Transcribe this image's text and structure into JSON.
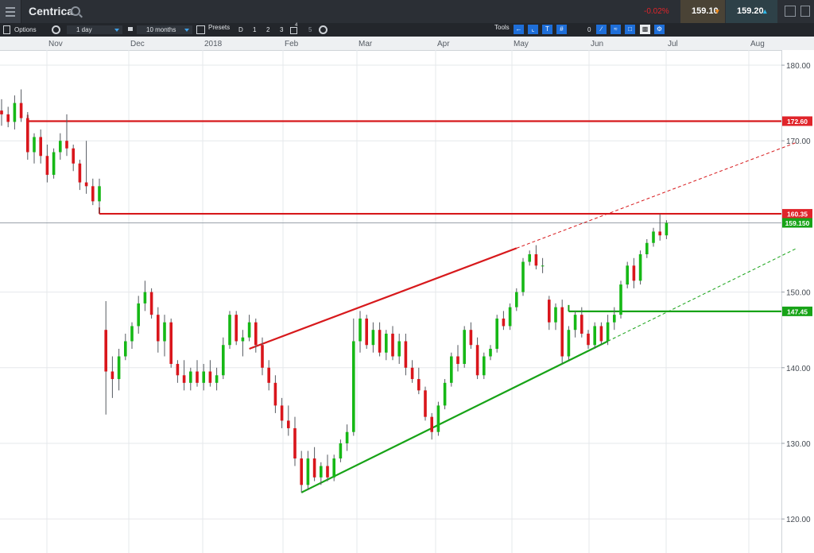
{
  "header": {
    "instrument": "Centrica",
    "change": "-0.02%",
    "sell_price": "159.10",
    "buy_price": "159.20"
  },
  "toolbar": {
    "options_label": "Options",
    "interval": "1 day",
    "range": "10 months",
    "presets_label": "Presets",
    "preset_buttons": [
      "D",
      "1",
      "2",
      "3",
      "4",
      "5"
    ],
    "tools_label": "Tools",
    "tool_zero": "0"
  },
  "chart_data": {
    "type": "candlestick",
    "x_labels": [
      "Nov",
      "Dec",
      "2018",
      "Feb",
      "Mar",
      "Apr",
      "May",
      "Jun",
      "Jul",
      "Aug"
    ],
    "y_ticks": [
      "180.00",
      "170.00",
      "150.00",
      "140.00",
      "130.00",
      "120.00"
    ],
    "ylim": [
      115.5,
      182.0
    ],
    "grid": true,
    "price_tags": [
      {
        "label": "172.60",
        "value": 172.6,
        "color": "#e0242a"
      },
      {
        "label": "160.35",
        "value": 160.35,
        "color": "#e0242a"
      },
      {
        "label": "159.150",
        "value": 159.15,
        "color": "#17a317"
      },
      {
        "label": "147.45",
        "value": 147.45,
        "color": "#17a317"
      }
    ],
    "horizontal_lines": [
      {
        "value": 172.6,
        "from_index": 4,
        "color": "#d7191c"
      },
      {
        "value": 160.35,
        "from_index": 15,
        "color": "#d7191c"
      },
      {
        "value": 147.45,
        "from_index": 87,
        "color": "#17a317"
      }
    ],
    "trend_lines": [
      {
        "from": [
          38,
          142.5
        ],
        "to": [
          79,
          155.8
        ],
        "color": "#d7191c"
      },
      {
        "from": [
          79,
          155.8
        ],
        "to": [
          122,
          169.8
        ],
        "color": "#d7191c",
        "dashed": true
      },
      {
        "from": [
          46,
          123.5
        ],
        "to": [
          93,
          143.5
        ],
        "color": "#17a317"
      },
      {
        "from": [
          93,
          143.5
        ],
        "to": [
          122,
          155.8
        ],
        "color": "#17a317",
        "dashed": true
      }
    ],
    "current_price": 159.15,
    "candles": [
      [
        174,
        175.5,
        172,
        173.5
      ],
      [
        173.5,
        174.5,
        171.8,
        172.5
      ],
      [
        172.5,
        176,
        171.5,
        175
      ],
      [
        175,
        176.8,
        172.5,
        173
      ],
      [
        173,
        173.8,
        167.5,
        168.5
      ],
      [
        168.5,
        171,
        167,
        170.5
      ],
      [
        170.5,
        171.5,
        167,
        168
      ],
      [
        168,
        169.5,
        164.5,
        165.5
      ],
      [
        165.5,
        169,
        165,
        168.5
      ],
      [
        168.5,
        171,
        167.5,
        170
      ],
      [
        170,
        173.5,
        168,
        169
      ],
      [
        169,
        169.5,
        166,
        167
      ],
      [
        167,
        167.5,
        163.5,
        164.5
      ],
      [
        164.5,
        170,
        163,
        164
      ],
      [
        164,
        165,
        161.5,
        162
      ],
      [
        162,
        165,
        160.4,
        164
      ],
      [
        145,
        148.8,
        133.8,
        139.5
      ],
      [
        139.5,
        141.5,
        136,
        138.5
      ],
      [
        138.5,
        142.5,
        137,
        141.5
      ],
      [
        141.5,
        144.5,
        141,
        143.5
      ],
      [
        143.5,
        146,
        142.5,
        145.5
      ],
      [
        145.5,
        149.5,
        144.5,
        148.5
      ],
      [
        148.5,
        151.5,
        147.5,
        150
      ],
      [
        150,
        150.5,
        146.5,
        147
      ],
      [
        147,
        148,
        142,
        143.5
      ],
      [
        143.5,
        147,
        141.5,
        146
      ],
      [
        146,
        146.5,
        140,
        140.5
      ],
      [
        140.5,
        141,
        138,
        139
      ],
      [
        139,
        141,
        137,
        138
      ],
      [
        138,
        140,
        137,
        139.5
      ],
      [
        139.5,
        141,
        137.5,
        138
      ],
      [
        138,
        140.5,
        137,
        139.5
      ],
      [
        139.5,
        141,
        137.5,
        138
      ],
      [
        138,
        140,
        137,
        139
      ],
      [
        139,
        144,
        138.5,
        143
      ],
      [
        143,
        147.5,
        142.5,
        147
      ],
      [
        147,
        147.5,
        143,
        143.5
      ],
      [
        143.5,
        145,
        141.5,
        144
      ],
      [
        144,
        147,
        143.5,
        146
      ],
      [
        146,
        146.5,
        142,
        143
      ],
      [
        143,
        144,
        139,
        140
      ],
      [
        140,
        141,
        137,
        138
      ],
      [
        138,
        139,
        134,
        135
      ],
      [
        135,
        136,
        132,
        133
      ],
      [
        133,
        135,
        131,
        132
      ],
      [
        132,
        133.5,
        127,
        128
      ],
      [
        128,
        129,
        123.5,
        124.5
      ],
      [
        124.5,
        129,
        123.8,
        128
      ],
      [
        128,
        129.5,
        125,
        125.5
      ],
      [
        125.5,
        127.5,
        124.5,
        127
      ],
      [
        127,
        128.5,
        125,
        125.5
      ],
      [
        125.5,
        128.5,
        125,
        128
      ],
      [
        128,
        130.5,
        127.5,
        130
      ],
      [
        130,
        132.5,
        129,
        131.5
      ],
      [
        131.5,
        146.5,
        131,
        143.5
      ],
      [
        143.5,
        147.5,
        142,
        146.5
      ],
      [
        146.5,
        147,
        142.5,
        143
      ],
      [
        143,
        146,
        142,
        145
      ],
      [
        145,
        146,
        141.5,
        142
      ],
      [
        142,
        145,
        141,
        144.5
      ],
      [
        144.5,
        145.5,
        141,
        141.5
      ],
      [
        141.5,
        144.5,
        140.5,
        143.5
      ],
      [
        143.5,
        144.5,
        139,
        140
      ],
      [
        140,
        141,
        138,
        138.5
      ],
      [
        138.5,
        140,
        136.5,
        137
      ],
      [
        137,
        137.5,
        133,
        133.5
      ],
      [
        133.5,
        134,
        130.5,
        131.5
      ],
      [
        131.5,
        135.5,
        131,
        135
      ],
      [
        135,
        138.5,
        134.5,
        138
      ],
      [
        138,
        142,
        137.5,
        141.5
      ],
      [
        141.5,
        143,
        139.5,
        140.5
      ],
      [
        140.5,
        145.5,
        140,
        145
      ],
      [
        145,
        146,
        142.5,
        143
      ],
      [
        143,
        144,
        138.5,
        139
      ],
      [
        139,
        142,
        138.5,
        141.5
      ],
      [
        141.5,
        143,
        141,
        142.5
      ],
      [
        142.5,
        147,
        142,
        146.5
      ],
      [
        146.5,
        147.5,
        145,
        145.5
      ],
      [
        145.5,
        148.5,
        145,
        148
      ],
      [
        148,
        150.5,
        147.5,
        150
      ],
      [
        150,
        154.5,
        149.5,
        154
      ],
      [
        154,
        155.5,
        153.5,
        155
      ],
      [
        155,
        156.2,
        153,
        153.5
      ],
      [
        153.5,
        154.5,
        152.5,
        153.5
      ],
      [
        149,
        149.5,
        145,
        146
      ],
      [
        146,
        148.5,
        145,
        148
      ],
      [
        148,
        149,
        140.5,
        141.5
      ],
      [
        141.5,
        145.5,
        141,
        145
      ],
      [
        145,
        147.5,
        144,
        147
      ],
      [
        147,
        148,
        144,
        144.5
      ],
      [
        144.5,
        145,
        142.5,
        143
      ],
      [
        143,
        146,
        142.5,
        145.5
      ],
      [
        145.5,
        146,
        143,
        143.5
      ],
      [
        143.5,
        147,
        143,
        146
      ],
      [
        146,
        148,
        145,
        147
      ],
      [
        147,
        151.5,
        146.5,
        151
      ],
      [
        151,
        154,
        150.5,
        153.5
      ],
      [
        153.5,
        154.5,
        150.5,
        151.5
      ],
      [
        151.5,
        155.5,
        151,
        155
      ],
      [
        155,
        157,
        154.5,
        156.5
      ],
      [
        156.5,
        158.5,
        156,
        158
      ],
      [
        158,
        160.3,
        156.8,
        157.5
      ],
      [
        157.5,
        159.5,
        157,
        159.15
      ]
    ]
  }
}
